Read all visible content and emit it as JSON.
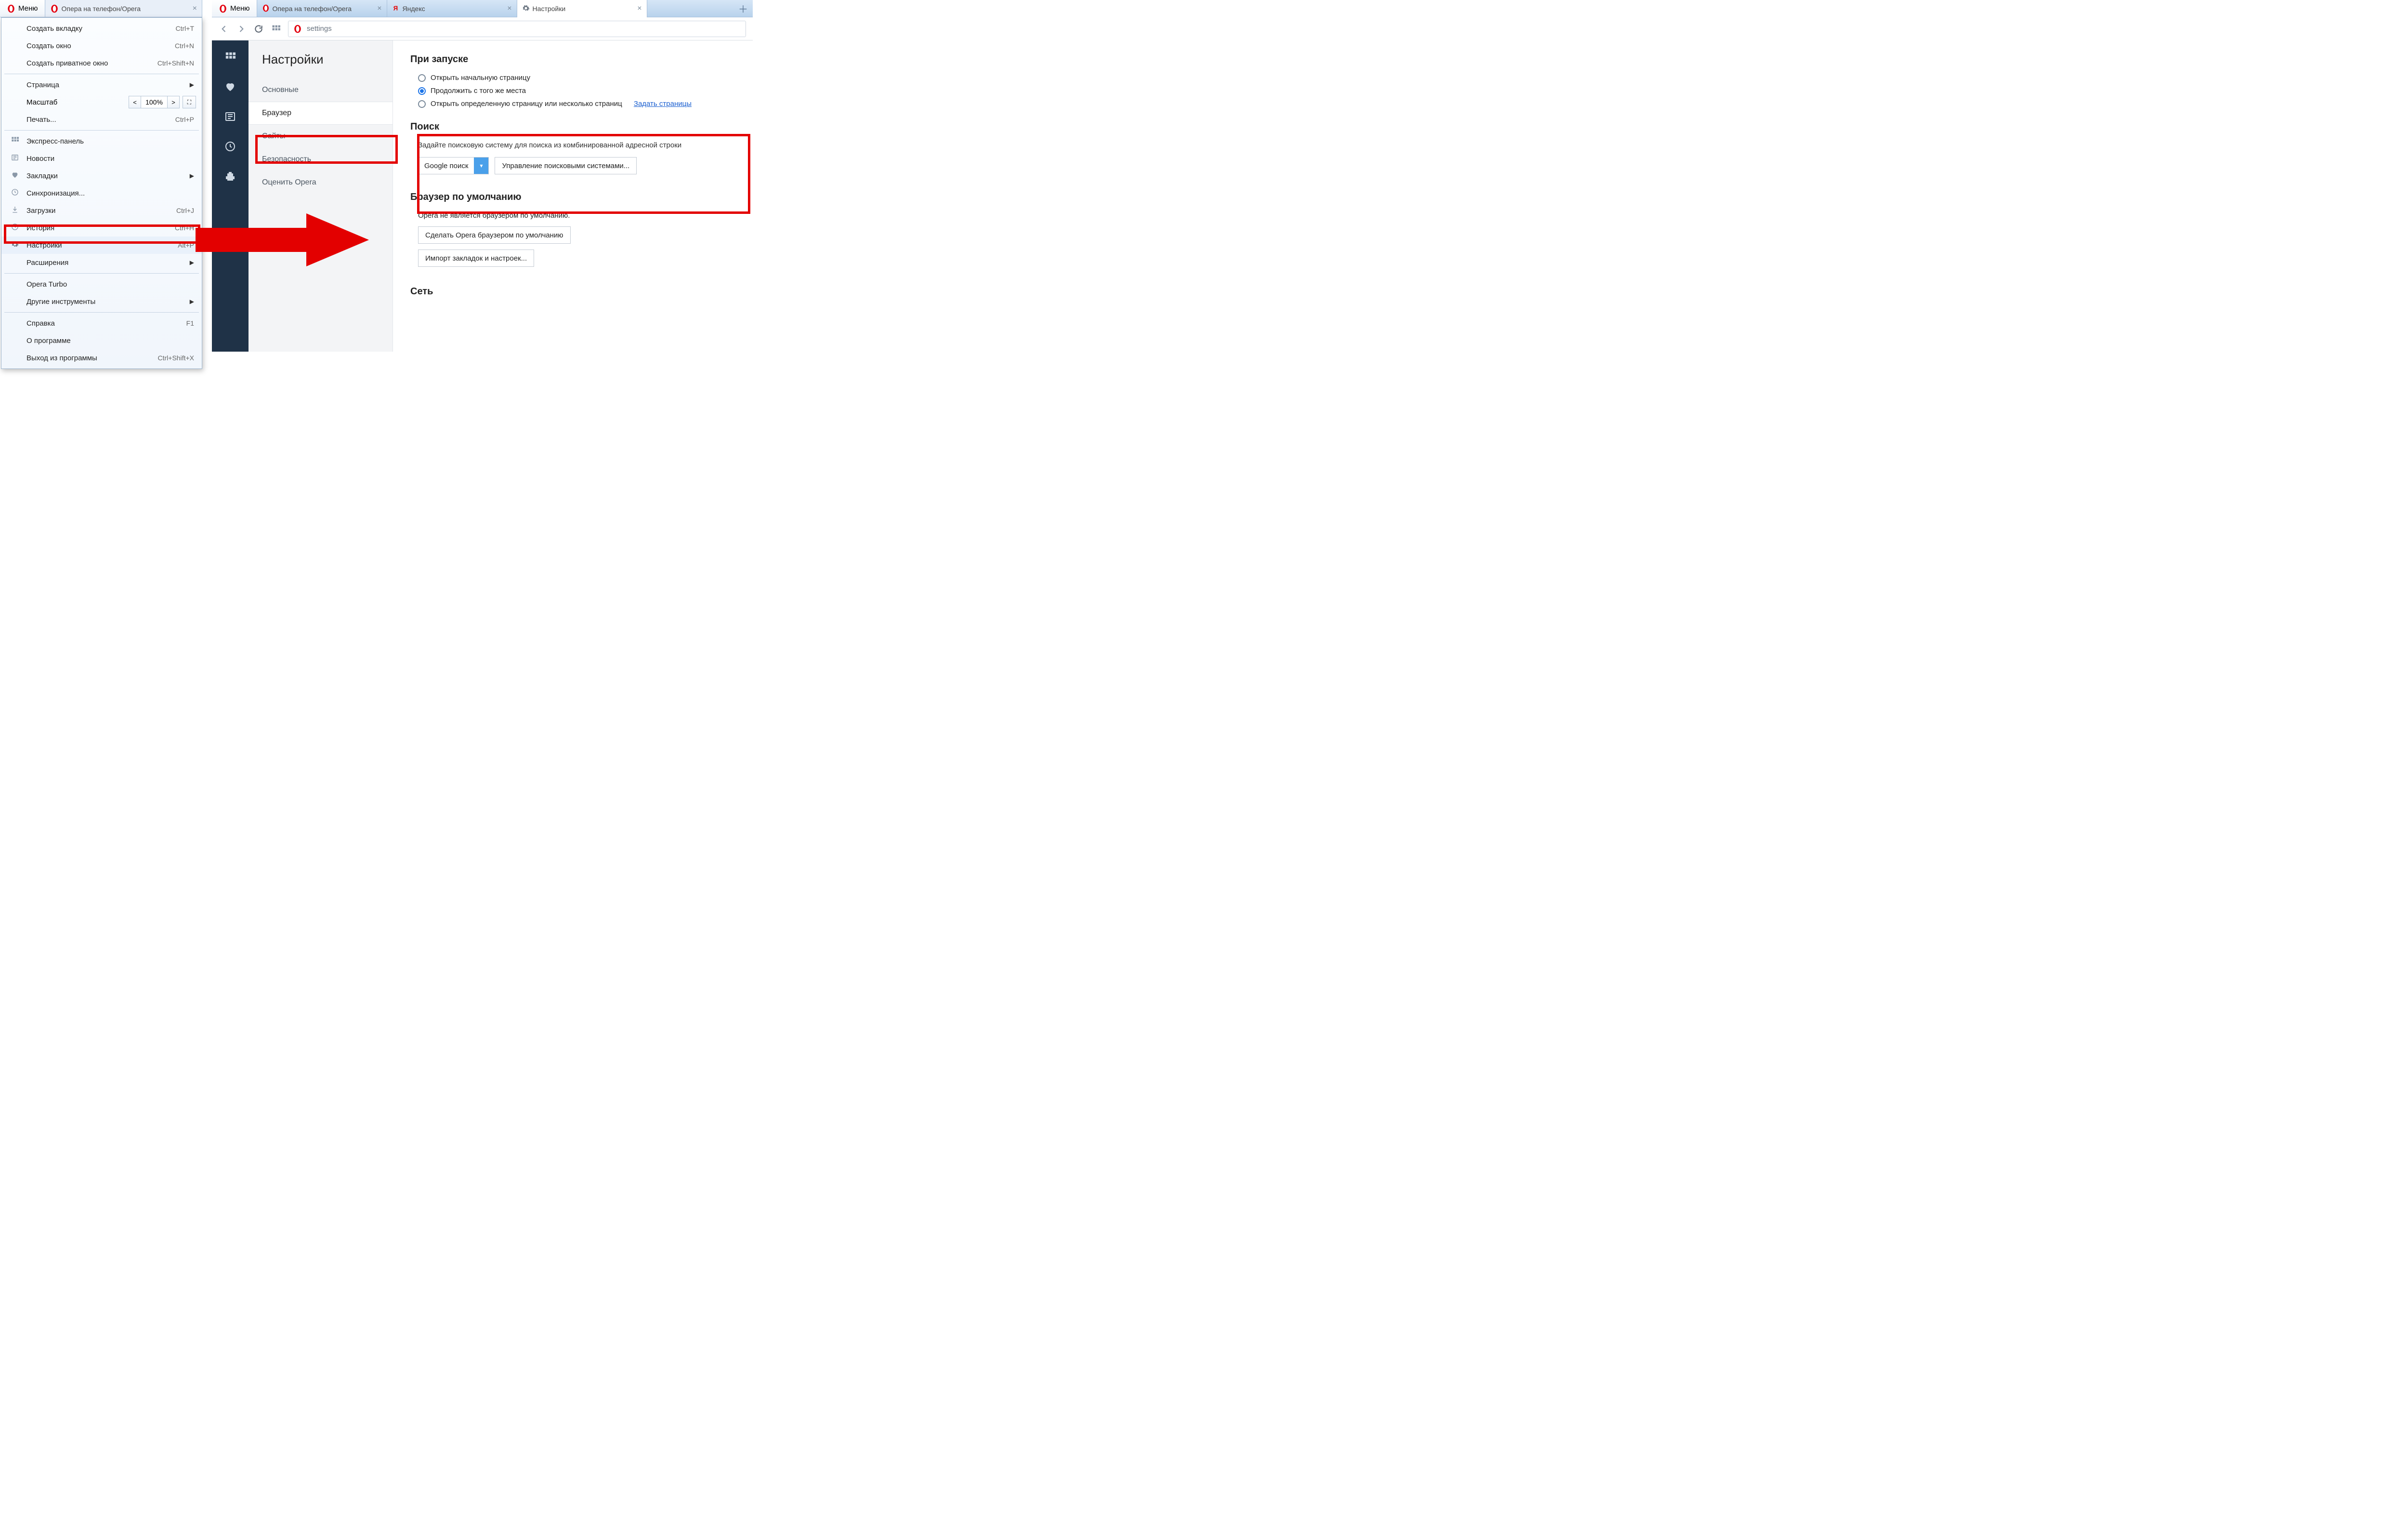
{
  "left": {
    "menu_label": "Меню",
    "tab_title": "Опера на телефон/Opera",
    "items": [
      {
        "label": "Создать вкладку",
        "shortcut": "Ctrl+T"
      },
      {
        "label": "Создать окно",
        "shortcut": "Ctrl+N"
      },
      {
        "label": "Создать приватное окно",
        "shortcut": "Ctrl+Shift+N"
      }
    ],
    "page_item": "Страница",
    "zoom_label": "Масштаб",
    "zoom_value": "100%",
    "print_item": {
      "label": "Печать...",
      "shortcut": "Ctrl+P"
    },
    "group2": [
      {
        "icon": "grid",
        "label": "Экспресс-панель"
      },
      {
        "icon": "news",
        "label": "Новости"
      },
      {
        "icon": "heart",
        "label": "Закладки",
        "arrow": true
      },
      {
        "icon": "clock",
        "label": "Синхронизация..."
      },
      {
        "icon": "download",
        "label": "Загрузки",
        "shortcut": "Ctrl+J"
      },
      {
        "icon": "history",
        "label": "История",
        "shortcut": "Ctrl+H"
      },
      {
        "icon": "gear",
        "label": "Настройки",
        "shortcut": "Alt+P",
        "highlight": true
      },
      {
        "label": "Расширения",
        "arrow": true
      }
    ],
    "group3": [
      {
        "label": "Opera Turbo"
      },
      {
        "label": "Другие инструменты",
        "arrow": true
      }
    ],
    "group4": [
      {
        "label": "Справка",
        "shortcut": "F1"
      },
      {
        "label": "О программе"
      },
      {
        "label": "Выход из программы",
        "shortcut": "Ctrl+Shift+X"
      }
    ]
  },
  "right": {
    "menu_label": "Меню",
    "tabs": [
      {
        "icon": "opera",
        "title": "Опера на телефон/Opera"
      },
      {
        "icon": "yandex",
        "title": "Яндекс"
      },
      {
        "icon": "gear",
        "title": "Настройки",
        "active": true
      }
    ],
    "url_text": "settings",
    "sidepanel": {
      "title": "Настройки",
      "items": [
        "Основные",
        "Браузер",
        "Сайты",
        "Безопасность",
        "Оценить Opera"
      ],
      "active_index": 1
    },
    "startup": {
      "heading": "При запуске",
      "opt1": "Открыть начальную страницу",
      "opt2": "Продолжить с того же места",
      "opt3": "Открыть определенную страницу или несколько страниц",
      "opt3_link": "Задать страницы",
      "selected": 1
    },
    "search": {
      "heading": "Поиск",
      "desc": "Задайте поисковую систему для поиска из комбинированной адресной строки",
      "engine": "Google поиск",
      "manage_btn": "Управление поисковыми системами..."
    },
    "default_browser": {
      "heading": "Браузер по умолчанию",
      "status": "Opera не является браузером по умолчанию.",
      "make_default_btn": "Сделать Opera браузером по умолчанию",
      "import_btn": "Импорт закладок и настроек..."
    },
    "network_heading": "Сеть"
  }
}
